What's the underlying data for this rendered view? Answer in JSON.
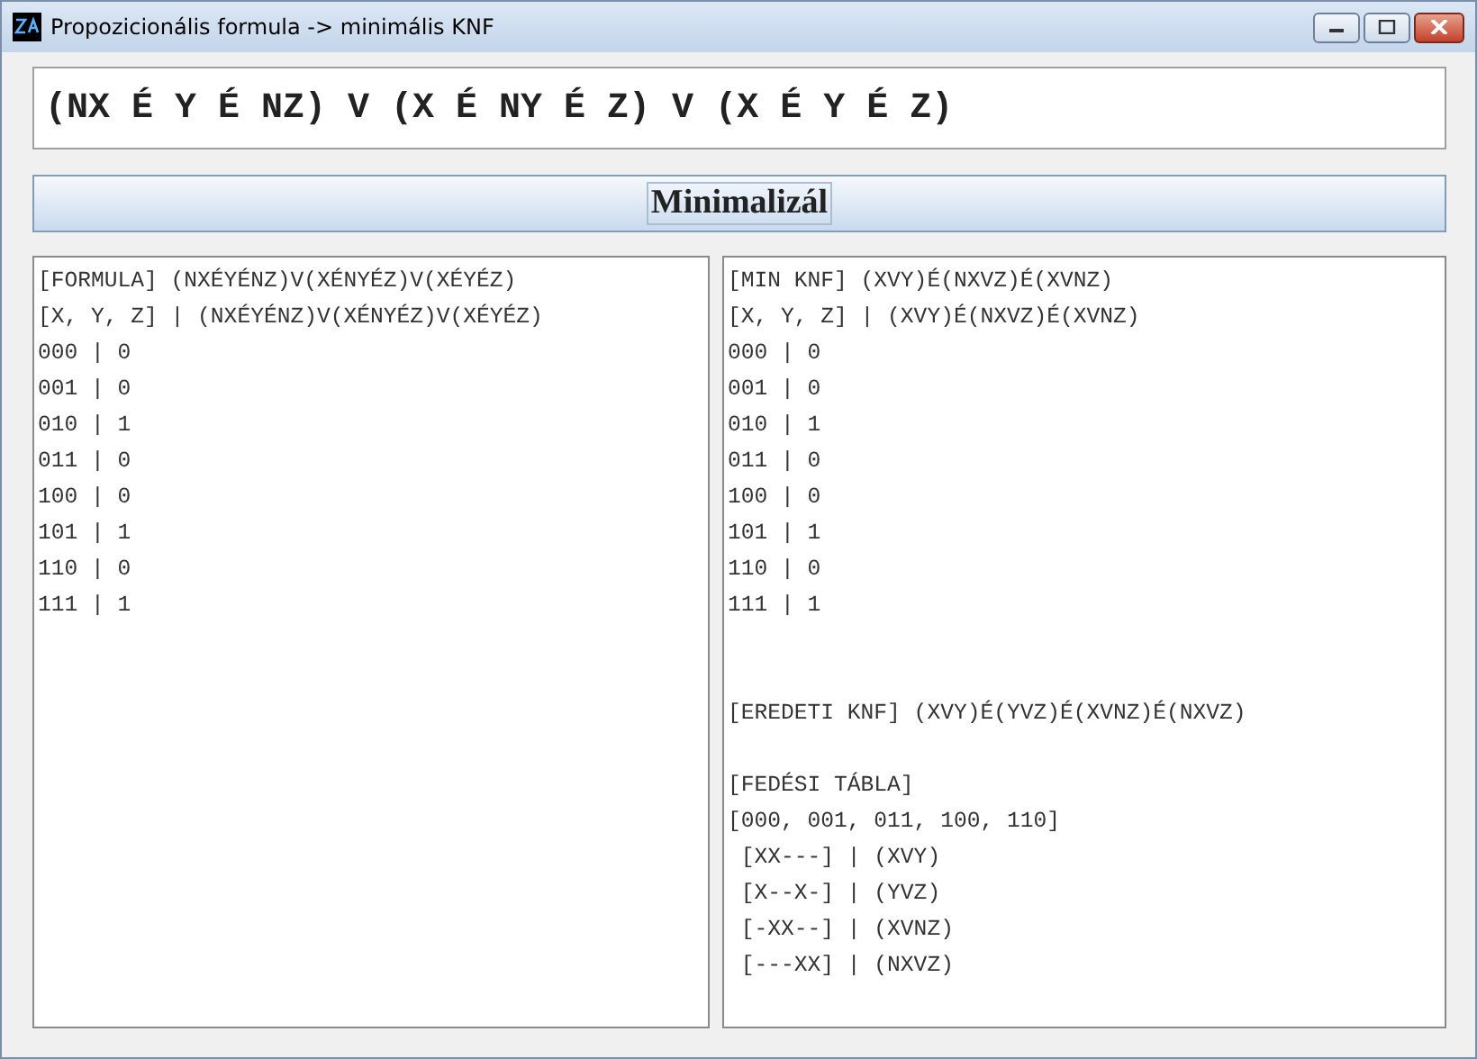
{
  "window": {
    "title": "Propozicionális formula -> minimális KNF"
  },
  "formula_field": {
    "value": "(NX É Y É NZ) V (X É NY É Z) V (X É Y É Z)"
  },
  "minimize_button": {
    "label": "Minimalizál",
    "focused": true
  },
  "left_pane": {
    "sections": [
      {
        "lines": [
          "[FORMULA] (NXÉYÉNZ)V(XÉNYÉZ)V(XÉYÉZ)",
          "[X, Y, Z] | (NXÉYÉNZ)V(XÉNYÉZ)V(XÉYÉZ)",
          "000 | 0",
          "001 | 0",
          "010 | 1",
          "011 | 0",
          "100 | 0",
          "101 | 1",
          "110 | 0",
          "111 | 1"
        ]
      }
    ]
  },
  "right_pane": {
    "sections": [
      {
        "lines": [
          "[MIN KNF] (XVY)É(NXVZ)É(XVNZ)",
          "[X, Y, Z] | (XVY)É(NXVZ)É(XVNZ)",
          "000 | 0",
          "001 | 0",
          "010 | 1",
          "011 | 0",
          "100 | 0",
          "101 | 1",
          "110 | 0",
          "111 | 1"
        ]
      },
      {
        "wide_gap_before": true,
        "lines": [
          "[EREDETI KNF] (XVY)É(YVZ)É(XVNZ)É(NXVZ)"
        ]
      },
      {
        "wide_gap_before": false,
        "lines": [
          "[FEDÉSI TÁBLA]",
          "[000, 001, 011, 100, 110]",
          " [XX---] | (XVY)",
          " [X--X-] | (YVZ)",
          " [-XX--] | (XVNZ)",
          " [---XX] | (NXVZ)"
        ]
      }
    ]
  }
}
